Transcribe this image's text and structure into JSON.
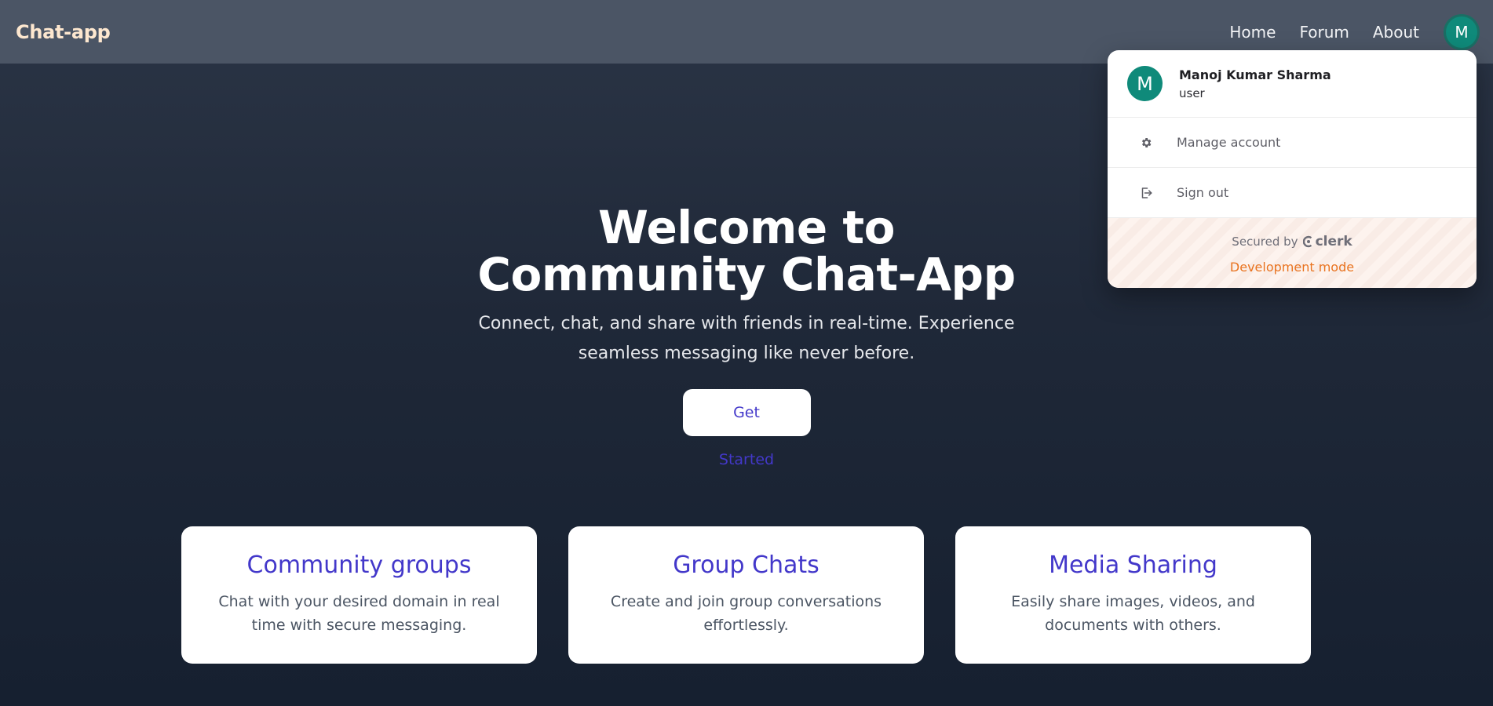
{
  "navbar": {
    "brand": "Chat-app",
    "links": [
      "Home",
      "Forum",
      "About"
    ],
    "avatar_initial": "M"
  },
  "hero": {
    "title": "Welcome to Community Chat-App",
    "subtitle": "Connect, chat, and share with friends in real-time. Experience seamless messaging like never before.",
    "cta_label": "Get Started"
  },
  "features": [
    {
      "title": "Community groups",
      "description": "Chat with your desired domain in real time with secure messaging."
    },
    {
      "title": "Group Chats",
      "description": "Create and join group conversations effortlessly."
    },
    {
      "title": "Media Sharing",
      "description": "Easily share images, videos, and documents with others."
    }
  ],
  "user_menu": {
    "avatar_initial": "M",
    "name": "Manoj Kumar Sharma",
    "role": "user",
    "items": [
      {
        "label": "Manage account",
        "icon": "gear-icon"
      },
      {
        "label": "Sign out",
        "icon": "sign-out-icon"
      }
    ],
    "secured_by": "Secured by",
    "provider": "clerk",
    "mode": "Development mode"
  },
  "colors": {
    "accent": "#4338ca",
    "avatar": "#0f8a7a",
    "dev_mode": "#e9731f",
    "brand": "#fde7cf"
  }
}
